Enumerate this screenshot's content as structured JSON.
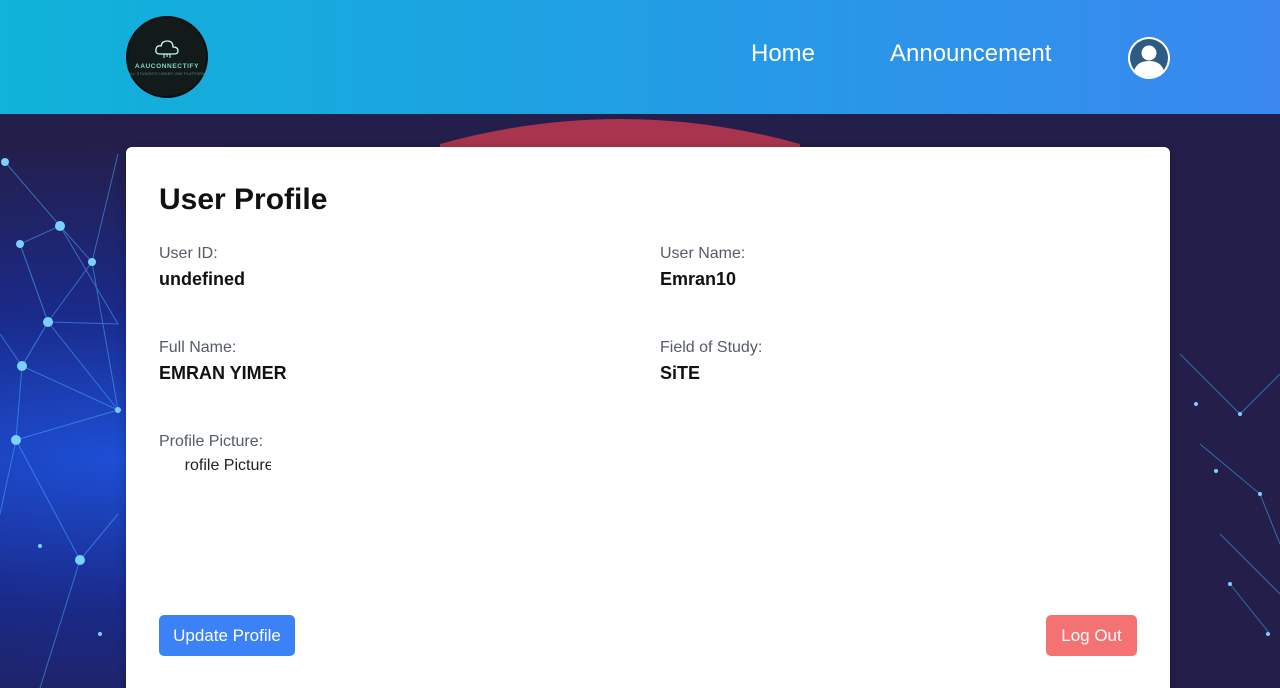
{
  "header": {
    "logo": {
      "name": "AAUCONNECTIFY",
      "tagline": "ALL STUDENTS UNDER ONE PLATFORM"
    },
    "nav": {
      "home": "Home",
      "announcement": "Announcement"
    }
  },
  "profile": {
    "title": "User Profile",
    "user_id_label": "User ID:",
    "user_id_value": "undefined",
    "user_name_label": "User Name:",
    "user_name_value": "Emran10",
    "full_name_label": "Full Name:",
    "full_name_value": "EMRAN YIMER",
    "field_label": "Field of Study:",
    "field_value": "SiTE",
    "picture_label": "Profile Picture:",
    "picture_alt": "Profile Picture"
  },
  "actions": {
    "update": "Update Profile",
    "logout": "Log Out"
  },
  "colors": {
    "header_start": "#10b3d9",
    "header_end": "#3a88f0",
    "update_btn": "#3b82f6",
    "logout_btn": "#f47272"
  }
}
